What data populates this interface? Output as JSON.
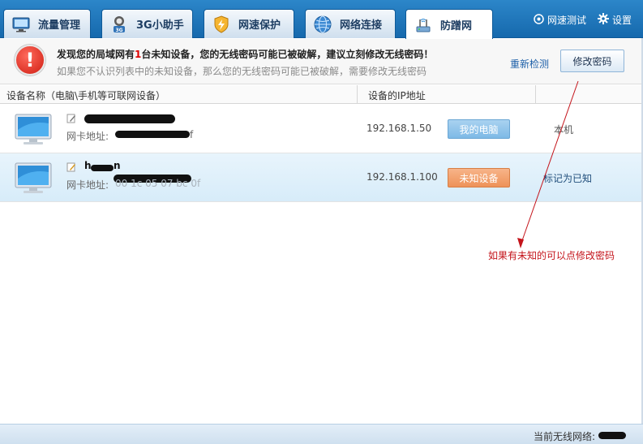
{
  "tabs": [
    {
      "label": "流量管理",
      "icon": "monitor-chart-icon"
    },
    {
      "label": "3G小助手",
      "icon": "3g-helper-icon"
    },
    {
      "label": "网速保护",
      "icon": "speed-shield-icon"
    },
    {
      "label": "网络连接",
      "icon": "globe-icon"
    },
    {
      "label": "防蹭网",
      "icon": "router-icon",
      "active": true
    }
  ],
  "top_links": {
    "speed_test": "网速测试",
    "settings": "设置"
  },
  "alert": {
    "line1_prefix": "发现您的局域网有",
    "count": "1",
    "line1_suffix": "台未知设备，您的无线密码可能已被破解，建议立刻修改无线密码！",
    "line2": "如果您不认识列表中的未知设备，那么您的无线密码可能已被破解，需要修改无线密码",
    "recheck": "重新检测",
    "change_password": "修改密码"
  },
  "columns": {
    "device_name": "设备名称（电脑\\手机等可联网设备）",
    "ip": "设备的IP地址"
  },
  "devices": [
    {
      "mac_label": "网卡地址:",
      "mac_visible_tail": "f",
      "ip": "192.168.1.50",
      "badge": "我的电脑",
      "action": "本机"
    },
    {
      "name_visible": "h",
      "name_visible_tail": "n",
      "mac_label": "网卡地址:",
      "mac_visible_tail": "00 1c 05 07 bc 0f",
      "ip": "192.168.1.100",
      "badge": "未知设备",
      "action": "标记为已知"
    }
  ],
  "annotation": "如果有未知的可以点修改密码",
  "status": {
    "label": "当前无线网络:"
  },
  "colors": {
    "topbar": "#1669ad",
    "warning_red": "#d00000",
    "mine_badge": "#7db9e6",
    "unknown_badge": "#ee9258",
    "annotation_red": "#c4141b"
  }
}
